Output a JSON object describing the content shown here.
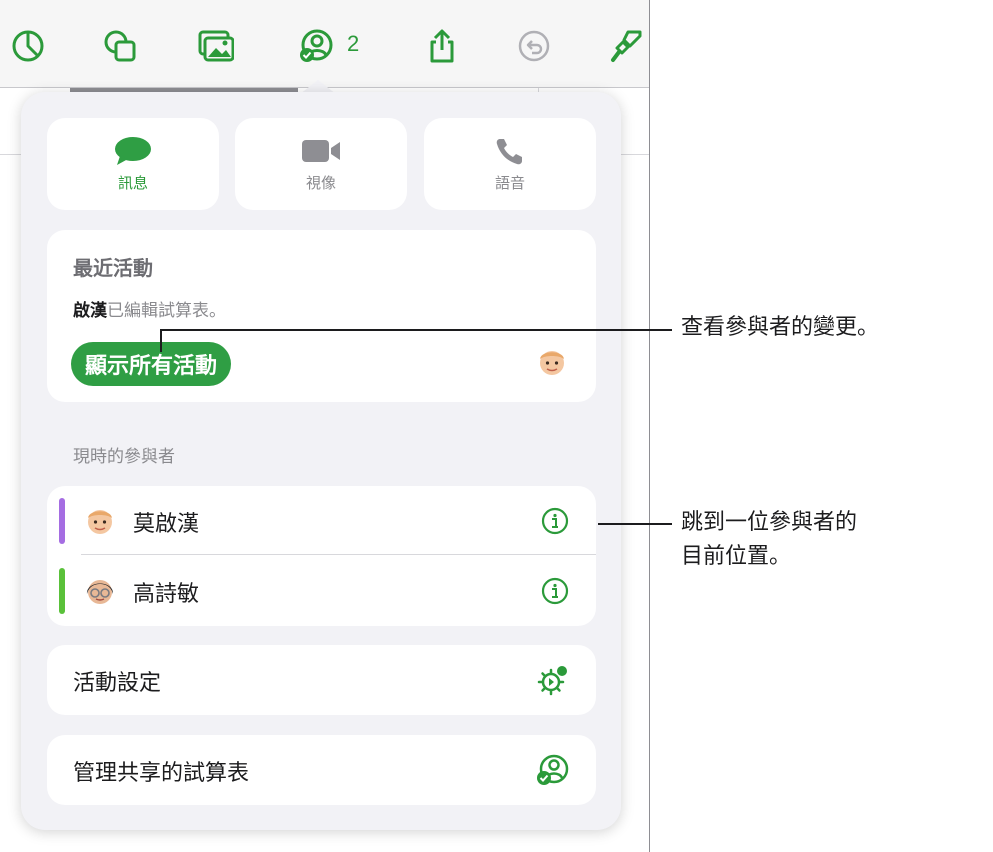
{
  "toolbar": {
    "collaborator_count": "2",
    "icons": [
      "format-icon",
      "shapes-icon",
      "media-icon",
      "collaborate-icon",
      "share-icon",
      "undo-icon",
      "paintbrush-icon"
    ]
  },
  "comm": {
    "message_label": "訊息",
    "video_label": "視像",
    "voice_label": "語音"
  },
  "activity": {
    "title": "最近活動",
    "editor_name": "啟漢",
    "edit_text": "已編輯試算表。",
    "show_all_label": "顯示所有活動"
  },
  "participants": {
    "heading": "現時的參與者",
    "items": [
      {
        "name": "莫啟漢",
        "color": "#a56de2"
      },
      {
        "name": "高詩敏",
        "color": "#5ac13a"
      }
    ]
  },
  "settings": {
    "activity_settings_label": "活動設定",
    "manage_label": "管理共享的試算表"
  },
  "callouts": {
    "view_changes": "查看參與者的變更。",
    "jump_line1": "跳到一位參與者的",
    "jump_line2": "目前位置。"
  },
  "colors": {
    "accent": "#2b9a3a",
    "popover_bg": "#f2f2f6"
  }
}
